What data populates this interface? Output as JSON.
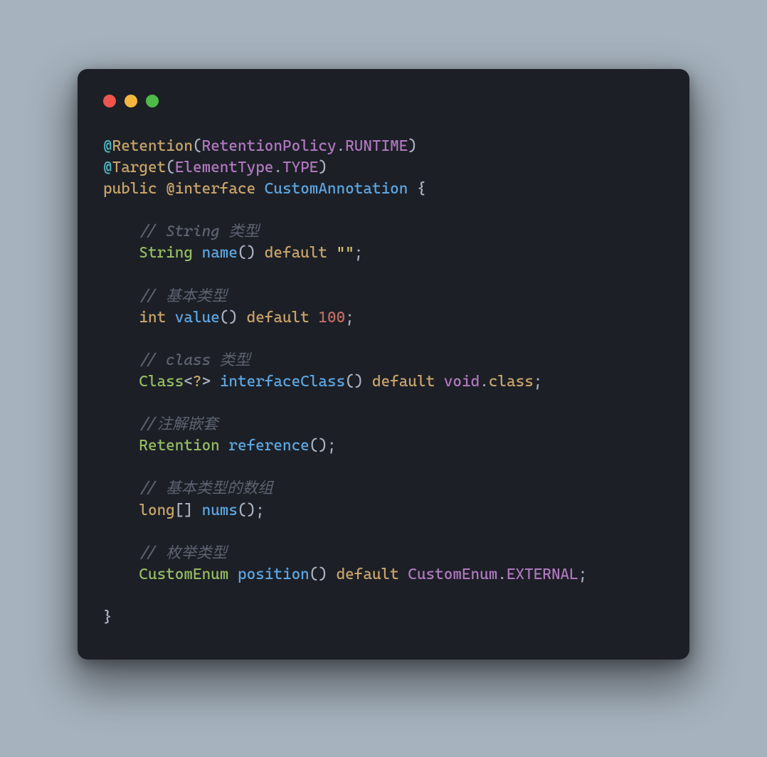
{
  "code": {
    "t_at1": "@",
    "t_Retention": "Retention",
    "t_lp1": "(",
    "t_RetentionPolicy": "RetentionPolicy",
    "t_dot1": ".",
    "t_RUNTIME": "RUNTIME",
    "t_rp1": ")",
    "t_at2": "@",
    "t_Target": "Target",
    "t_lp2": "(",
    "t_ElementType": "ElementType",
    "t_dot2": ".",
    "t_TYPE": "TYPE",
    "t_rp2": ")",
    "t_public": "public",
    "t_atinterface": "@interface",
    "t_CustomAnnotation": "CustomAnnotation",
    "t_brace_open": " {",
    "t_c1": "// String 类型",
    "t_String": "String",
    "t_name": "name",
    "t_parens_name": "()",
    "t_default1": " default ",
    "t_emptystr": "\"\"",
    "t_semi1": ";",
    "t_c2": "// 基本类型",
    "t_int": "int",
    "t_value": "value",
    "t_parens_value": "()",
    "t_default2": " default ",
    "t_100": "100",
    "t_semi2": ";",
    "t_c3": "// class 类型",
    "t_Class": "Class",
    "t_lt": "<",
    "t_qm": "?",
    "t_gt": ">",
    "t_interfaceClass": "interfaceClass",
    "t_parens_ic": "()",
    "t_default3": " default ",
    "t_void": "void",
    "t_dot3": ".",
    "t_class_lit": "class",
    "t_semi3": ";",
    "t_c4": "//注解嵌套",
    "t_Retention2": "Retention",
    "t_reference": "reference",
    "t_parens_ref": "()",
    "t_semi4": ";",
    "t_c5": "// 基本类型的数组",
    "t_long": "long",
    "t_brackets": "[]",
    "t_nums": "nums",
    "t_parens_nums": "()",
    "t_semi5": ";",
    "t_c6": "// 枚举类型",
    "t_CustomEnum": "CustomEnum",
    "t_position": "position",
    "t_parens_pos": "()",
    "t_default4": " default ",
    "t_CustomEnum2": "CustomEnum",
    "t_dot4": ".",
    "t_EXTERNAL": "EXTERNAL",
    "t_semi6": ";",
    "t_brace_close": "}"
  }
}
